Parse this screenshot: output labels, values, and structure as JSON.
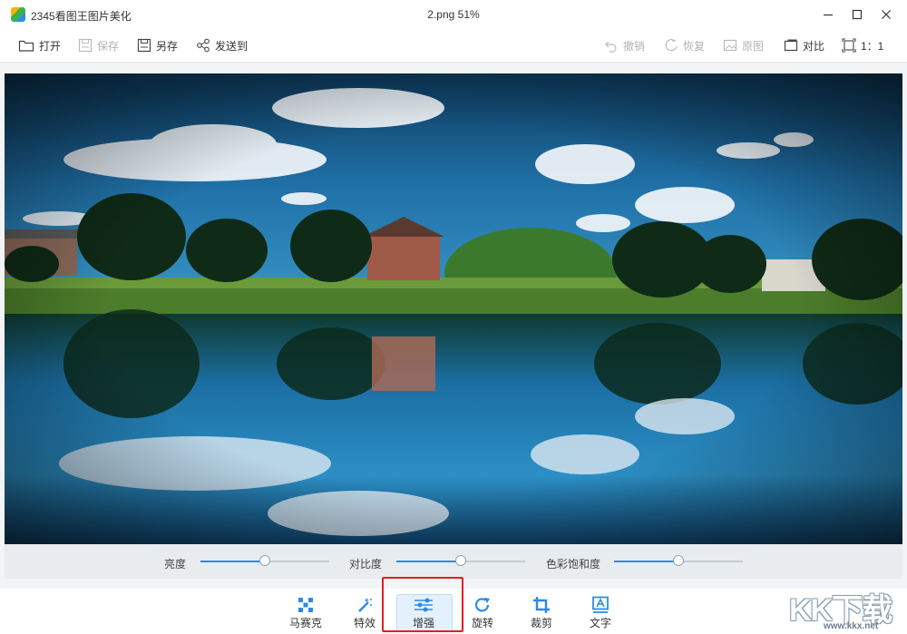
{
  "titlebar": {
    "app_title": "2345看图王图片美化",
    "document": "2.png   51%"
  },
  "toolbar": {
    "open": "打开",
    "save": "保存",
    "save_as": "另存",
    "send_to": "发送到",
    "undo": "撤销",
    "redo": "恢复",
    "original": "原图",
    "compare": "对比",
    "ratio": "1：1"
  },
  "adjust": {
    "brightness": {
      "label": "亮度",
      "value": 0.5
    },
    "contrast": {
      "label": "对比度",
      "value": 0.5
    },
    "saturation": {
      "label": "色彩饱和度",
      "value": 0.5
    }
  },
  "tools": {
    "mosaic": "马赛克",
    "effects": "特效",
    "enhance": "增强",
    "rotate": "旋转",
    "crop": "裁剪",
    "text": "文字"
  },
  "watermark": {
    "brand": "KK下载",
    "url": "www.kkx.net"
  },
  "icons": {
    "open": "folder-icon",
    "save": "save-icon",
    "save_as": "save-as-icon",
    "send_to": "share-icon",
    "undo": "undo-icon",
    "redo": "redo-icon",
    "original": "image-icon",
    "compare": "compare-icon",
    "ratio": "fit-icon"
  },
  "colors": {
    "accent": "#2b8ce6",
    "highlight": "#e02020"
  }
}
